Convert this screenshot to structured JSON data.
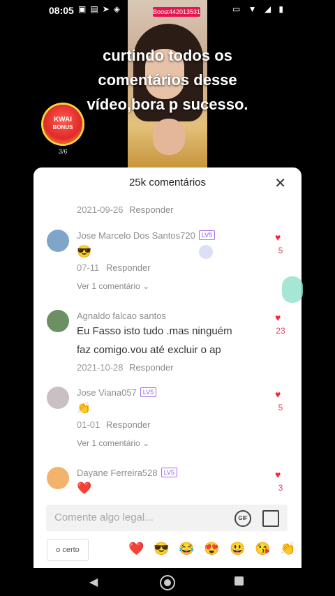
{
  "status": {
    "time": "08:05"
  },
  "video": {
    "boost_label": "Boost442013531",
    "caption": "curtindo todos os comentários desse vídeo,bora p sucesso."
  },
  "bonus": {
    "title1": "KWAI",
    "title2": "BONUS",
    "progress": "3/6"
  },
  "panel": {
    "title": "25k comentários",
    "close": "✕",
    "comments": [
      {
        "date": "2021-09-26",
        "reply": "Responder"
      },
      {
        "user": "Jose Marcelo Dos Santos720",
        "level": "LV5",
        "text": "😎",
        "date": "07-11",
        "reply": "Responder",
        "more": "Ver 1 comentário",
        "likes": "5",
        "avatar_color": "#7fa6c9"
      },
      {
        "user": "Agnaldo falcao santos",
        "text_line1": "Eu Fasso isto tudo .mas ninguém",
        "text_line2": "faz comigo.vou até excluir o ap",
        "date": "2021-10-28",
        "reply": "Responder",
        "likes": "23",
        "avatar_color": "#6c8f64"
      },
      {
        "user": "Jose Viana057",
        "level": "LV5",
        "text": "👏",
        "date": "01-01",
        "reply": "Responder",
        "more": "Ver 1 comentário",
        "likes": "5",
        "avatar_color": "#c9c0c4"
      },
      {
        "user": "Dayane Ferreira528",
        "level": "LV5",
        "text": "❤️",
        "likes": "3",
        "avatar_color": "#f2b36d"
      }
    ]
  },
  "input": {
    "placeholder": "Comente algo legal...",
    "gif": "GIF"
  },
  "quick": {
    "chip": "o certo",
    "emojis": [
      "❤️",
      "😎",
      "😂",
      "😍",
      "😃",
      "😘",
      "👏"
    ]
  },
  "colors": {
    "accent": "#e94057",
    "level_border": "#a56cf0"
  }
}
